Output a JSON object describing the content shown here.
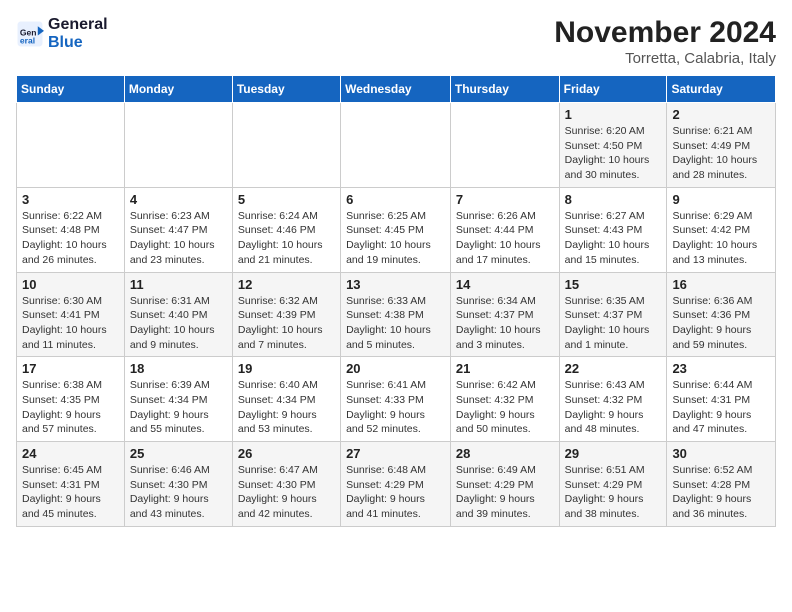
{
  "logo": {
    "name1": "General",
    "name2": "Blue"
  },
  "title": "November 2024",
  "location": "Torretta, Calabria, Italy",
  "weekdays": [
    "Sunday",
    "Monday",
    "Tuesday",
    "Wednesday",
    "Thursday",
    "Friday",
    "Saturday"
  ],
  "weeks": [
    [
      {
        "day": "",
        "info": ""
      },
      {
        "day": "",
        "info": ""
      },
      {
        "day": "",
        "info": ""
      },
      {
        "day": "",
        "info": ""
      },
      {
        "day": "",
        "info": ""
      },
      {
        "day": "1",
        "info": "Sunrise: 6:20 AM\nSunset: 4:50 PM\nDaylight: 10 hours\nand 30 minutes."
      },
      {
        "day": "2",
        "info": "Sunrise: 6:21 AM\nSunset: 4:49 PM\nDaylight: 10 hours\nand 28 minutes."
      }
    ],
    [
      {
        "day": "3",
        "info": "Sunrise: 6:22 AM\nSunset: 4:48 PM\nDaylight: 10 hours\nand 26 minutes."
      },
      {
        "day": "4",
        "info": "Sunrise: 6:23 AM\nSunset: 4:47 PM\nDaylight: 10 hours\nand 23 minutes."
      },
      {
        "day": "5",
        "info": "Sunrise: 6:24 AM\nSunset: 4:46 PM\nDaylight: 10 hours\nand 21 minutes."
      },
      {
        "day": "6",
        "info": "Sunrise: 6:25 AM\nSunset: 4:45 PM\nDaylight: 10 hours\nand 19 minutes."
      },
      {
        "day": "7",
        "info": "Sunrise: 6:26 AM\nSunset: 4:44 PM\nDaylight: 10 hours\nand 17 minutes."
      },
      {
        "day": "8",
        "info": "Sunrise: 6:27 AM\nSunset: 4:43 PM\nDaylight: 10 hours\nand 15 minutes."
      },
      {
        "day": "9",
        "info": "Sunrise: 6:29 AM\nSunset: 4:42 PM\nDaylight: 10 hours\nand 13 minutes."
      }
    ],
    [
      {
        "day": "10",
        "info": "Sunrise: 6:30 AM\nSunset: 4:41 PM\nDaylight: 10 hours\nand 11 minutes."
      },
      {
        "day": "11",
        "info": "Sunrise: 6:31 AM\nSunset: 4:40 PM\nDaylight: 10 hours\nand 9 minutes."
      },
      {
        "day": "12",
        "info": "Sunrise: 6:32 AM\nSunset: 4:39 PM\nDaylight: 10 hours\nand 7 minutes."
      },
      {
        "day": "13",
        "info": "Sunrise: 6:33 AM\nSunset: 4:38 PM\nDaylight: 10 hours\nand 5 minutes."
      },
      {
        "day": "14",
        "info": "Sunrise: 6:34 AM\nSunset: 4:37 PM\nDaylight: 10 hours\nand 3 minutes."
      },
      {
        "day": "15",
        "info": "Sunrise: 6:35 AM\nSunset: 4:37 PM\nDaylight: 10 hours\nand 1 minute."
      },
      {
        "day": "16",
        "info": "Sunrise: 6:36 AM\nSunset: 4:36 PM\nDaylight: 9 hours\nand 59 minutes."
      }
    ],
    [
      {
        "day": "17",
        "info": "Sunrise: 6:38 AM\nSunset: 4:35 PM\nDaylight: 9 hours\nand 57 minutes."
      },
      {
        "day": "18",
        "info": "Sunrise: 6:39 AM\nSunset: 4:34 PM\nDaylight: 9 hours\nand 55 minutes."
      },
      {
        "day": "19",
        "info": "Sunrise: 6:40 AM\nSunset: 4:34 PM\nDaylight: 9 hours\nand 53 minutes."
      },
      {
        "day": "20",
        "info": "Sunrise: 6:41 AM\nSunset: 4:33 PM\nDaylight: 9 hours\nand 52 minutes."
      },
      {
        "day": "21",
        "info": "Sunrise: 6:42 AM\nSunset: 4:32 PM\nDaylight: 9 hours\nand 50 minutes."
      },
      {
        "day": "22",
        "info": "Sunrise: 6:43 AM\nSunset: 4:32 PM\nDaylight: 9 hours\nand 48 minutes."
      },
      {
        "day": "23",
        "info": "Sunrise: 6:44 AM\nSunset: 4:31 PM\nDaylight: 9 hours\nand 47 minutes."
      }
    ],
    [
      {
        "day": "24",
        "info": "Sunrise: 6:45 AM\nSunset: 4:31 PM\nDaylight: 9 hours\nand 45 minutes."
      },
      {
        "day": "25",
        "info": "Sunrise: 6:46 AM\nSunset: 4:30 PM\nDaylight: 9 hours\nand 43 minutes."
      },
      {
        "day": "26",
        "info": "Sunrise: 6:47 AM\nSunset: 4:30 PM\nDaylight: 9 hours\nand 42 minutes."
      },
      {
        "day": "27",
        "info": "Sunrise: 6:48 AM\nSunset: 4:29 PM\nDaylight: 9 hours\nand 41 minutes."
      },
      {
        "day": "28",
        "info": "Sunrise: 6:49 AM\nSunset: 4:29 PM\nDaylight: 9 hours\nand 39 minutes."
      },
      {
        "day": "29",
        "info": "Sunrise: 6:51 AM\nSunset: 4:29 PM\nDaylight: 9 hours\nand 38 minutes."
      },
      {
        "day": "30",
        "info": "Sunrise: 6:52 AM\nSunset: 4:28 PM\nDaylight: 9 hours\nand 36 minutes."
      }
    ]
  ]
}
